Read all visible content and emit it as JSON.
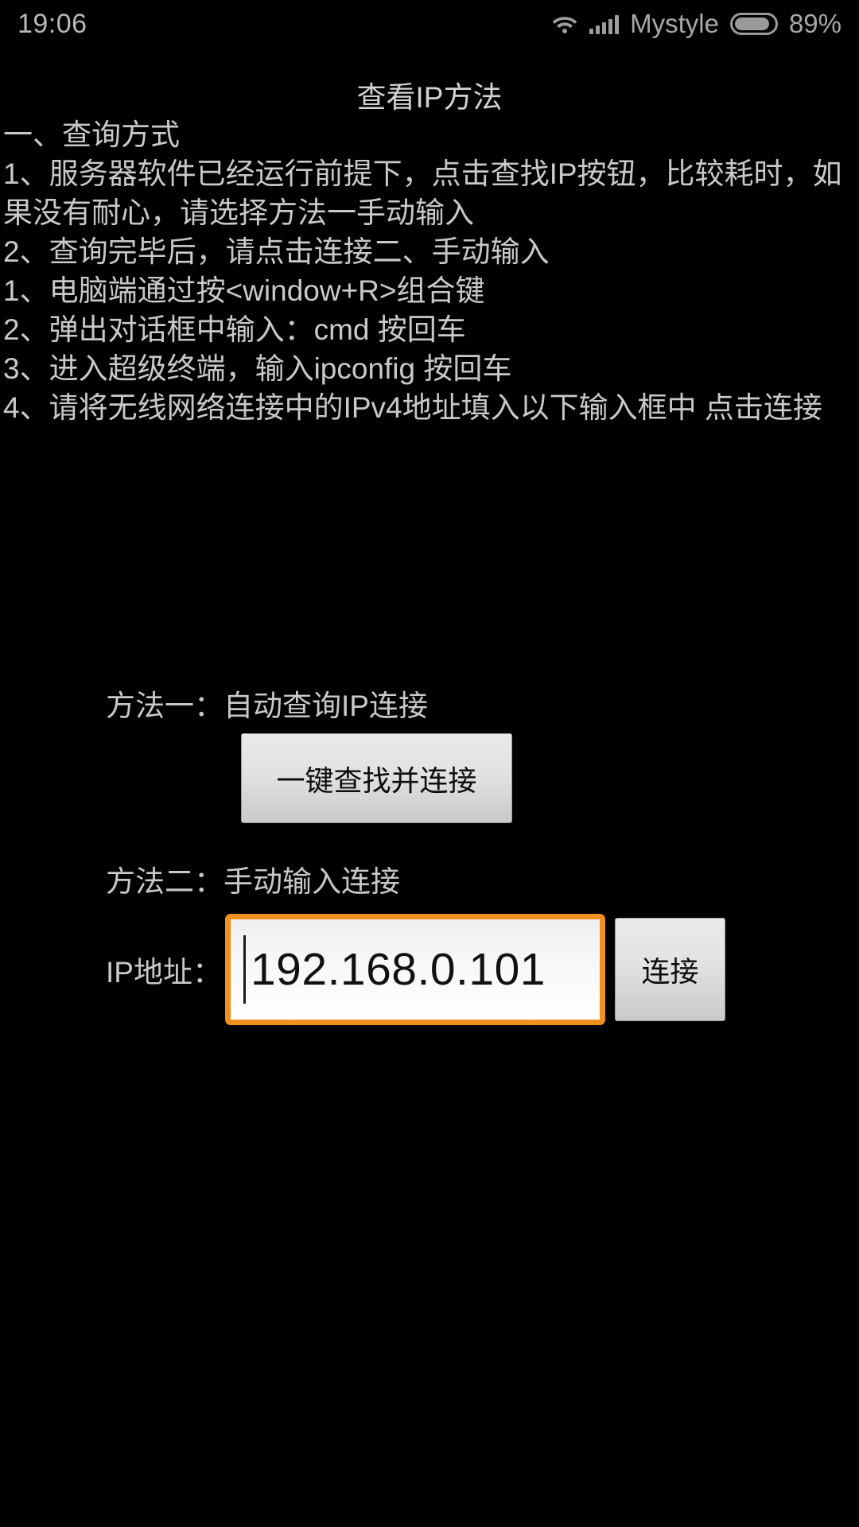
{
  "status_bar": {
    "time": "19:06",
    "carrier": "Mystyle",
    "battery_percent": "89%",
    "battery_level": 89,
    "wifi_icon": "wifi-icon",
    "signal_icon": "signal-bars-icon",
    "battery_icon": "battery-icon",
    "text_color": "#a8a8a8"
  },
  "page": {
    "title": "查看IP方法",
    "background": "#000000",
    "text_color": "#c9c9c9"
  },
  "instructions": {
    "lines": [
      "一、查询方式",
      "1、服务器软件已经运行前提下，点击查找IP按钮，比较耗时，如果没有耐心，请选择方法一手动输入",
      "2、查询完毕后，请点击连接二、手动输入",
      "1、电脑端通过按<window+R>组合键",
      "2、弹出对话框中输入：cmd 按回车",
      "3、进入超级终端，输入ipconfig 按回车",
      "4、请将无线网络连接中的IPv4地址填入以下输入框中 点击连接"
    ]
  },
  "method_one": {
    "label": "方法一：自动查询IP连接",
    "button_label": "一键查找并连接"
  },
  "method_two": {
    "label": "方法二：手动输入连接",
    "ip_label": "IP地址：",
    "ip_value": "192.168.0.101",
    "ip_placeholder": "192.168.0.101",
    "connect_button_label": "连接",
    "focus_border_color": "#f0901f"
  }
}
